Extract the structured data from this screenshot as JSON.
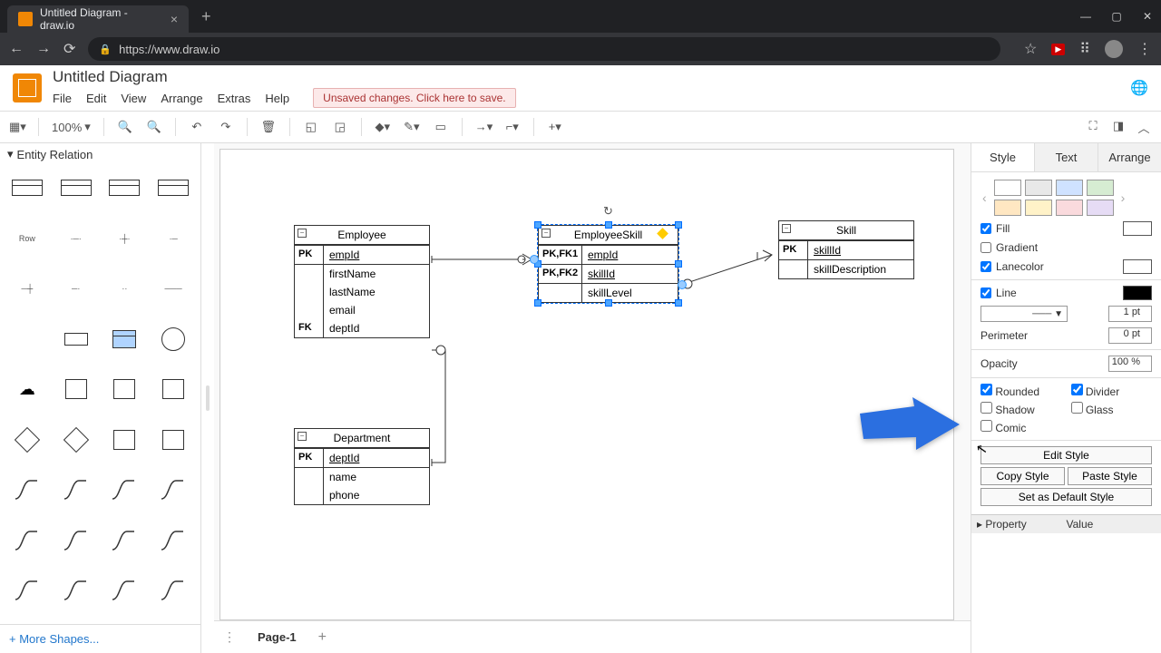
{
  "browser": {
    "tab_title": "Untitled Diagram - draw.io",
    "url": "https://www.draw.io"
  },
  "app": {
    "title": "Untitled Diagram",
    "menu": {
      "file": "File",
      "edit": "Edit",
      "view": "View",
      "arrange": "Arrange",
      "extras": "Extras",
      "help": "Help"
    },
    "save_warning": "Unsaved changes. Click here to save."
  },
  "toolbar": {
    "zoom": "100%"
  },
  "sidebar": {
    "section": "Entity Relation",
    "row_label": "Row",
    "more": "More Shapes..."
  },
  "canvas": {
    "entities": {
      "employee": {
        "title": "Employee",
        "rows": [
          {
            "key": "PK",
            "val": "empId",
            "u": true,
            "div": true
          },
          {
            "key": "",
            "val": "firstName",
            "div": true
          },
          {
            "key": "",
            "val": "lastName"
          },
          {
            "key": "",
            "val": "email"
          },
          {
            "key": "FK",
            "val": "deptId"
          }
        ]
      },
      "empskill": {
        "title": "EmployeeSkill",
        "rows": [
          {
            "key": "PK,FK1",
            "val": "empId",
            "u": true,
            "div": true
          },
          {
            "key": "PK,FK2",
            "val": "skillId",
            "u": true,
            "div": true
          },
          {
            "key": "",
            "val": "skillLevel",
            "div": true
          }
        ]
      },
      "skill": {
        "title": "Skill",
        "rows": [
          {
            "key": "PK",
            "val": "skillId",
            "u": true,
            "div": true
          },
          {
            "key": "",
            "val": "skillDescription",
            "div": true
          }
        ]
      },
      "dept": {
        "title": "Department",
        "rows": [
          {
            "key": "PK",
            "val": "deptId",
            "u": true,
            "div": true
          },
          {
            "key": "",
            "val": "name",
            "div": true
          },
          {
            "key": "",
            "val": "phone"
          }
        ]
      }
    }
  },
  "right_panel": {
    "tabs": {
      "style": "Style",
      "text": "Text",
      "arrange": "Arrange"
    },
    "fill": "Fill",
    "gradient": "Gradient",
    "lanecolor": "Lanecolor",
    "line": "Line",
    "line_width": "1 pt",
    "perimeter": "Perimeter",
    "perimeter_val": "0 pt",
    "opacity": "Opacity",
    "opacity_val": "100 %",
    "rounded": "Rounded",
    "divider": "Divider",
    "shadow": "Shadow",
    "glass": "Glass",
    "comic": "Comic",
    "edit_style": "Edit Style",
    "copy_style": "Copy Style",
    "paste_style": "Paste Style",
    "set_default": "Set as Default Style",
    "property": "Property",
    "value": "Value"
  },
  "pages": {
    "page1": "Page-1"
  }
}
